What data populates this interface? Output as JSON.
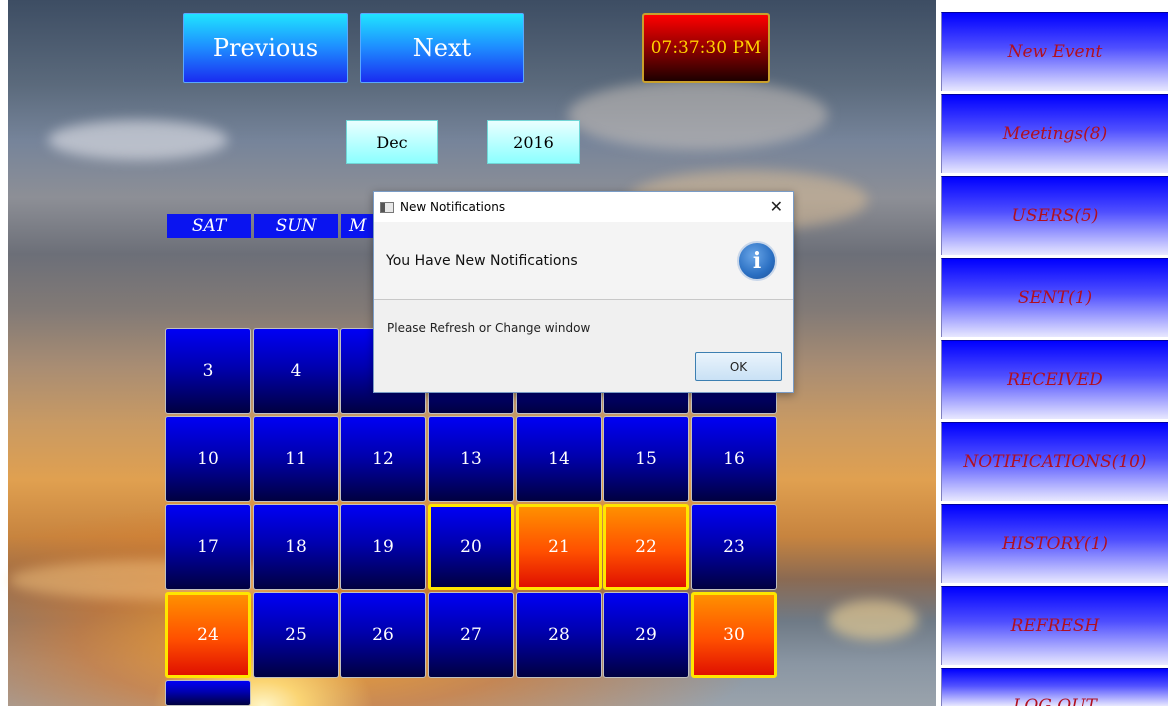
{
  "nav": {
    "previous_label": "Previous",
    "next_label": "Next",
    "clock": "07:37:30 PM"
  },
  "selectors": {
    "month": "Dec",
    "year": "2016"
  },
  "day_headers": [
    "SAT",
    "SUN",
    "M"
  ],
  "calendar": {
    "row1": [
      "3",
      "4"
    ],
    "row2": [
      "10",
      "11",
      "12",
      "13",
      "14",
      "15",
      "16"
    ],
    "row3": [
      "17",
      "18",
      "19",
      "20",
      "21",
      "22",
      "23"
    ],
    "row4": [
      "24",
      "25",
      "26",
      "27",
      "28",
      "29",
      "30"
    ]
  },
  "sidebar": {
    "items": [
      "New Event",
      "Meetings(8)",
      "USERS(5)",
      "SENT(1)",
      "RECEIVED",
      "NOTIFICATIONS(10)",
      "HISTORY(1)",
      "REFRESH",
      "LOG OUT"
    ]
  },
  "dialog": {
    "title": "New Notifications",
    "close_glyph": "✕",
    "header": "You Have New Notifications",
    "info_glyph": "i",
    "message": "Please Refresh or Change window",
    "ok_label": "OK"
  }
}
